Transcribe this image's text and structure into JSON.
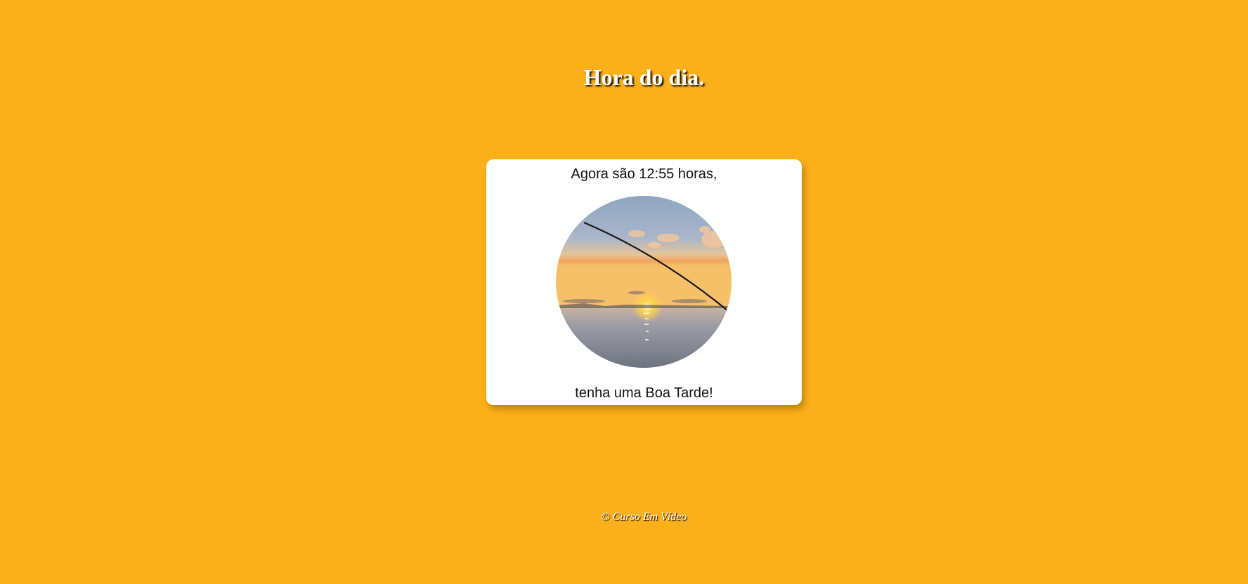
{
  "page": {
    "title": "Hora do dia.",
    "background_color": "#fbb01a"
  },
  "card": {
    "time_message": "Agora são 12:55 horas,",
    "greeting": "tenha uma Boa Tarde!",
    "image_description_icon": "sunset-fishing-photo"
  },
  "footer": {
    "copyright": "© Curso Em Vídeo"
  }
}
